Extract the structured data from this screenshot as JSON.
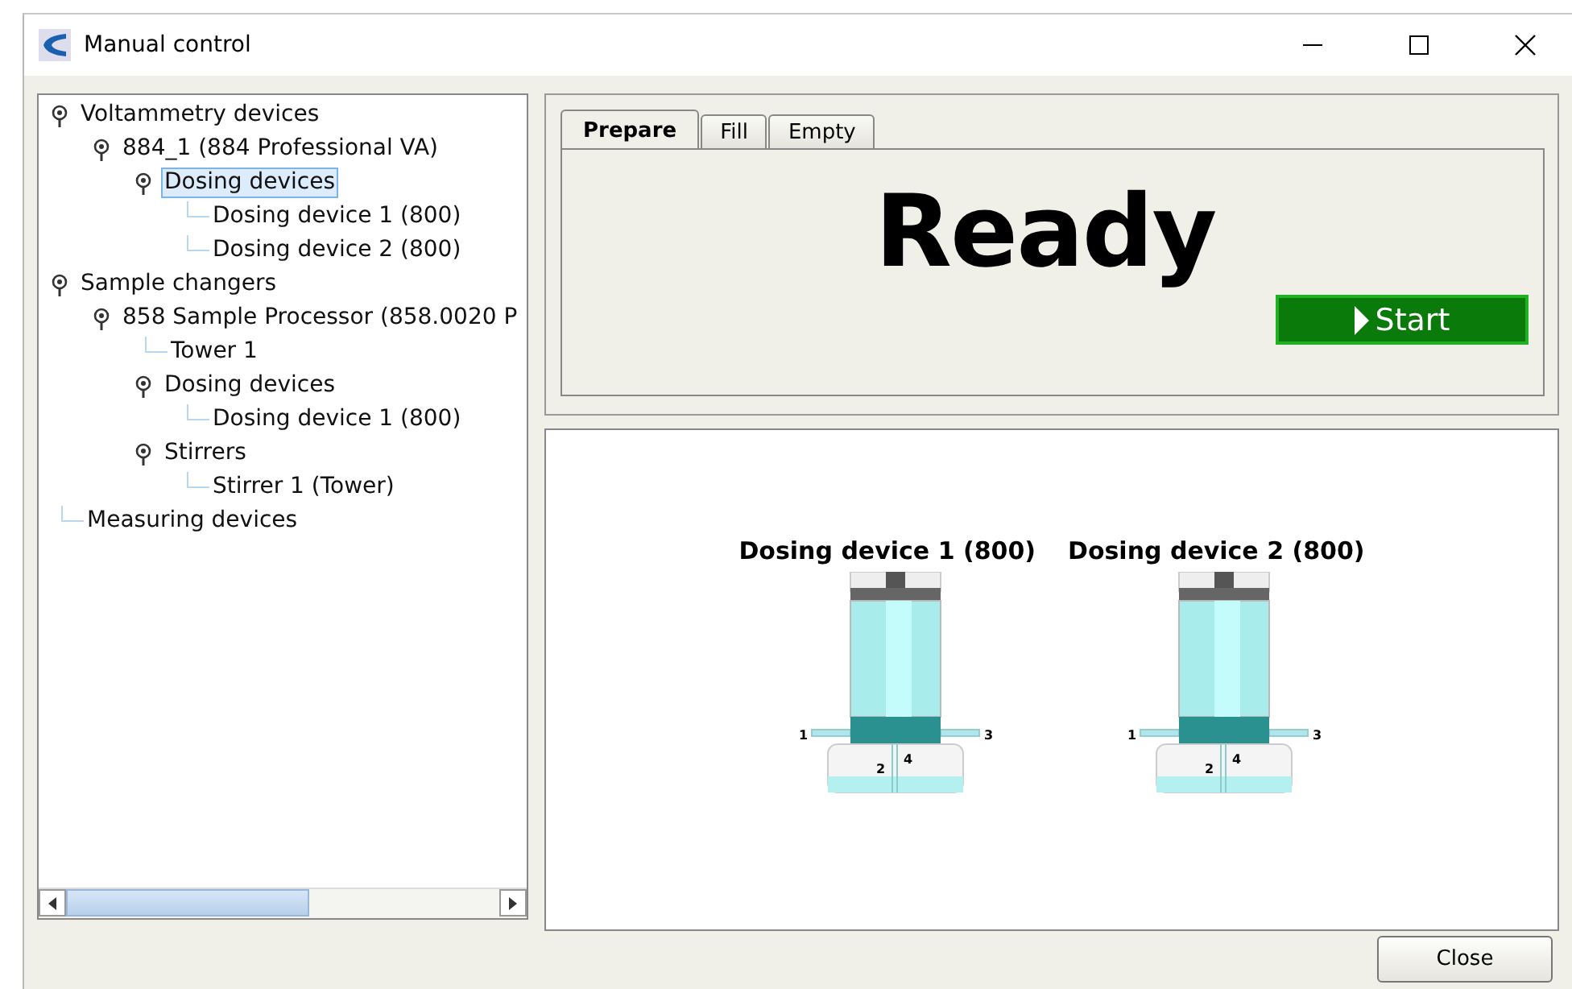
{
  "window": {
    "title": "Manual control"
  },
  "tree": [
    {
      "label": "Voltammetry devices",
      "selected": false,
      "expanded": true,
      "children": [
        {
          "label": "884_1 (884 Professional VA)",
          "selected": false,
          "expanded": true,
          "children": [
            {
              "label": "Dosing devices",
              "selected": true,
              "expanded": true,
              "children": [
                {
                  "label": "Dosing device 1 (800)",
                  "selected": false
                },
                {
                  "label": "Dosing device 2 (800)",
                  "selected": false
                }
              ]
            }
          ]
        }
      ]
    },
    {
      "label": "Sample changers",
      "selected": false,
      "expanded": true,
      "children": [
        {
          "label": "858 Sample Processor (858.0020 P",
          "selected": false,
          "expanded": true,
          "children": [
            {
              "label": "Tower 1",
              "selected": false
            },
            {
              "label": "Dosing devices",
              "selected": false,
              "expanded": true,
              "children": [
                {
                  "label": "Dosing device 1 (800)",
                  "selected": false
                }
              ]
            },
            {
              "label": "Stirrers",
              "selected": false,
              "expanded": true,
              "children": [
                {
                  "label": "Stirrer 1 (Tower)",
                  "selected": false
                }
              ]
            }
          ]
        }
      ]
    },
    {
      "label": "Measuring devices",
      "selected": false
    }
  ],
  "tabs": [
    {
      "label": "Prepare",
      "selected": true
    },
    {
      "label": "Fill",
      "selected": false
    },
    {
      "label": "Empty",
      "selected": false
    }
  ],
  "status": "Ready",
  "start_button": "Start",
  "dosing_units": [
    {
      "name": "Dosing device 1 (800)",
      "ports": [
        "1",
        "2",
        "3",
        "4"
      ]
    },
    {
      "name": "Dosing device 2 (800)",
      "ports": [
        "1",
        "2",
        "3",
        "4"
      ]
    }
  ],
  "close_button": "Close"
}
